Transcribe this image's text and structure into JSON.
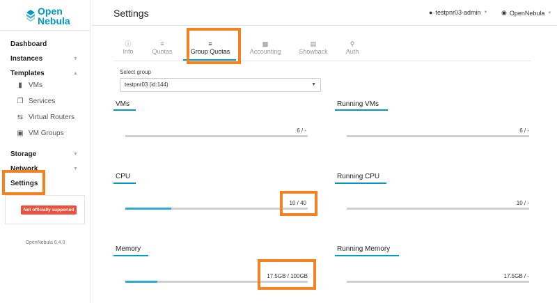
{
  "app": {
    "logo_line1": "Open",
    "logo_line2": "Nebula",
    "version": "OpenNebula 6.4.0",
    "support_badge": "Not officially supported"
  },
  "sidebar": {
    "items": [
      {
        "label": "Dashboard"
      },
      {
        "label": "Instances"
      },
      {
        "label": "Templates"
      },
      {
        "label": "VMs",
        "icon": "file-icon"
      },
      {
        "label": "Services",
        "icon": "files-icon"
      },
      {
        "label": "Virtual Routers",
        "icon": "shuffle-icon"
      },
      {
        "label": "VM Groups",
        "icon": "folder-icon"
      },
      {
        "label": "Storage"
      },
      {
        "label": "Network"
      },
      {
        "label": "Settings"
      }
    ]
  },
  "header": {
    "title": "Settings",
    "user": "testpnr03-admin",
    "zone": "OpenNebula"
  },
  "tabs": [
    {
      "label": "Info",
      "icon": "info-icon"
    },
    {
      "label": "Quotas",
      "icon": "list-icon"
    },
    {
      "label": "Group Quotas",
      "icon": "list-icon",
      "active": true
    },
    {
      "label": "Accounting",
      "icon": "bar-chart-icon"
    },
    {
      "label": "Showback",
      "icon": "money-icon"
    },
    {
      "label": "Auth",
      "icon": "key-icon"
    }
  ],
  "group_select": {
    "label": "Select group",
    "value": "testpnr03 (id:144)"
  },
  "quotas": {
    "vms": {
      "title": "VMs",
      "value": "6 / -",
      "fill": 0
    },
    "running_vms": {
      "title": "Running VMs",
      "value": "6 / -",
      "fill": 0
    },
    "cpu": {
      "title": "CPU",
      "value": "10 / 40",
      "fill": 0.25
    },
    "running_cpu": {
      "title": "Running CPU",
      "value": "10 / -",
      "fill": 0
    },
    "memory": {
      "title": "Memory",
      "value": "17.5GB / 100GB",
      "fill": 0.175
    },
    "running_memory": {
      "title": "Running Memory",
      "value": "17.5GB / -",
      "fill": 0
    }
  },
  "colors": {
    "accent": "#0098c3",
    "bar_fill": "#2fa8d6",
    "highlight": "#f58220",
    "badge": "#e8523f"
  }
}
